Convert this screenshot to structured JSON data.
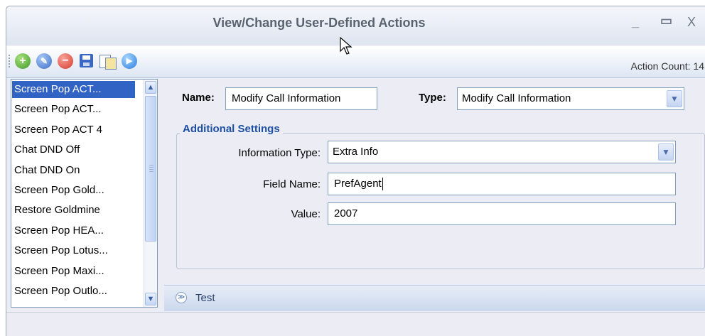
{
  "window": {
    "title": "View/Change User-Defined Actions",
    "minimize": "_",
    "maximize": "▭",
    "close": "X"
  },
  "toolbar": {
    "action_count": "Action Count: 14",
    "buttons": [
      {
        "name": "add-icon",
        "glyph": "+",
        "color": "#3f9b2b"
      },
      {
        "name": "edit-icon",
        "glyph": "✎",
        "color": "#3c6fc9"
      },
      {
        "name": "delete-icon",
        "glyph": "−",
        "color": "#d83a2e"
      },
      {
        "name": "save-icon",
        "glyph": "",
        "color": "#3a67c4"
      },
      {
        "name": "copy-icon",
        "glyph": "",
        "color": "#6f8ab5"
      },
      {
        "name": "run-icon",
        "glyph": "▶",
        "color": "#2a7de0"
      }
    ]
  },
  "action_list": {
    "items": [
      "Screen Pop ACT...",
      "Screen Pop ACT...",
      "Screen Pop ACT 4",
      "Chat DND Off",
      "Chat DND On",
      "Screen Pop Gold...",
      "Restore Goldmine",
      "Screen Pop HEA...",
      "Screen Pop Lotus...",
      "Screen Pop Maxi...",
      "Screen Pop Outlo..."
    ],
    "selected_index": 0
  },
  "form": {
    "name_label": "Name:",
    "name_value": "Modify Call Information",
    "type_label": "Type:",
    "type_value": "Modify Call Information",
    "group_title": "Additional Settings",
    "info_type_label": "Information Type:",
    "info_type_value": "Extra Info",
    "field_name_label": "Field Name:",
    "field_name_value": "PrefAgent",
    "value_label": "Value:",
    "value_value": "2007"
  },
  "test_bar": {
    "label": "Test"
  },
  "colors": {
    "selection": "#3163c5",
    "group_title": "#1d4fa3"
  }
}
